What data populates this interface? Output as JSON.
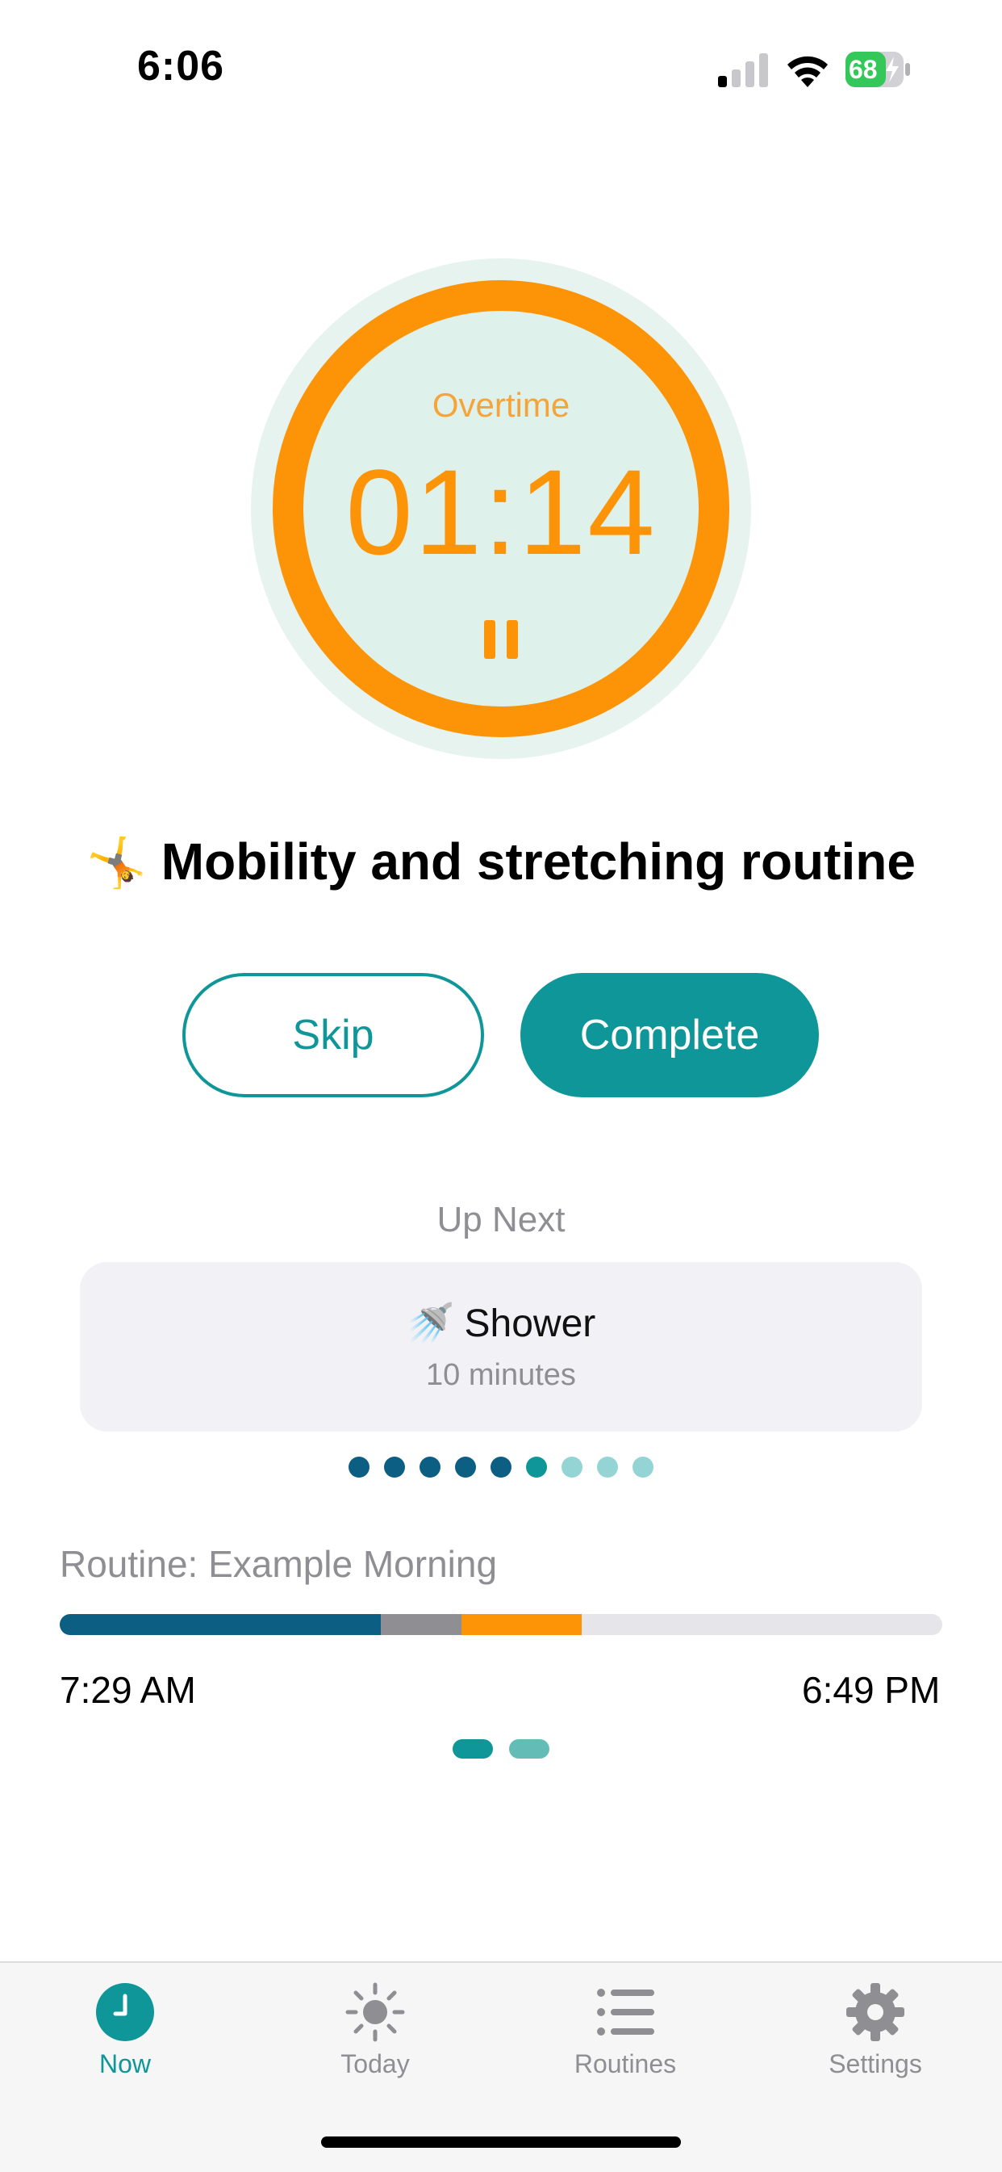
{
  "status_bar": {
    "time": "6:06",
    "battery": "68"
  },
  "timer": {
    "status": "Overtime",
    "value": "01:14"
  },
  "current": {
    "emoji": "🤸",
    "title": "Mobility and stretching routine"
  },
  "actions": {
    "skip_label": "Skip",
    "complete_label": "Complete"
  },
  "up_next": {
    "label": "Up Next",
    "emoji": "🚿",
    "name": "Shower",
    "duration": "10 minutes"
  },
  "page_dots": {
    "count": 9,
    "colors": [
      "#0c5e83",
      "#0c5e83",
      "#0c5e83",
      "#0c5e83",
      "#0c5e83",
      "#0f9698",
      "#94d4d4",
      "#94d4d4",
      "#94d4d4"
    ]
  },
  "routine": {
    "label": "Routine: Example Morning",
    "start_time": "7:29 AM",
    "end_time": "6:49 PM",
    "progress_segments": [
      {
        "fraction": 0.364,
        "color": "#0c5e83"
      },
      {
        "fraction": 0.091,
        "color": "#8e8e93"
      },
      {
        "fraction": 0.136,
        "color": "#fd9408"
      }
    ]
  },
  "pager": {
    "colors": [
      "#0f9698",
      "#63bdb6"
    ]
  },
  "tabs": [
    {
      "label": "Now",
      "icon": "clock-icon",
      "active": true
    },
    {
      "label": "Today",
      "icon": "sun-icon",
      "active": false
    },
    {
      "label": "Routines",
      "icon": "list-icon",
      "active": false
    },
    {
      "label": "Settings",
      "icon": "gear-icon",
      "active": false
    }
  ],
  "colors": {
    "accent": "#0f9698",
    "overtime": "#fd9408",
    "navy": "#0c5e83"
  }
}
